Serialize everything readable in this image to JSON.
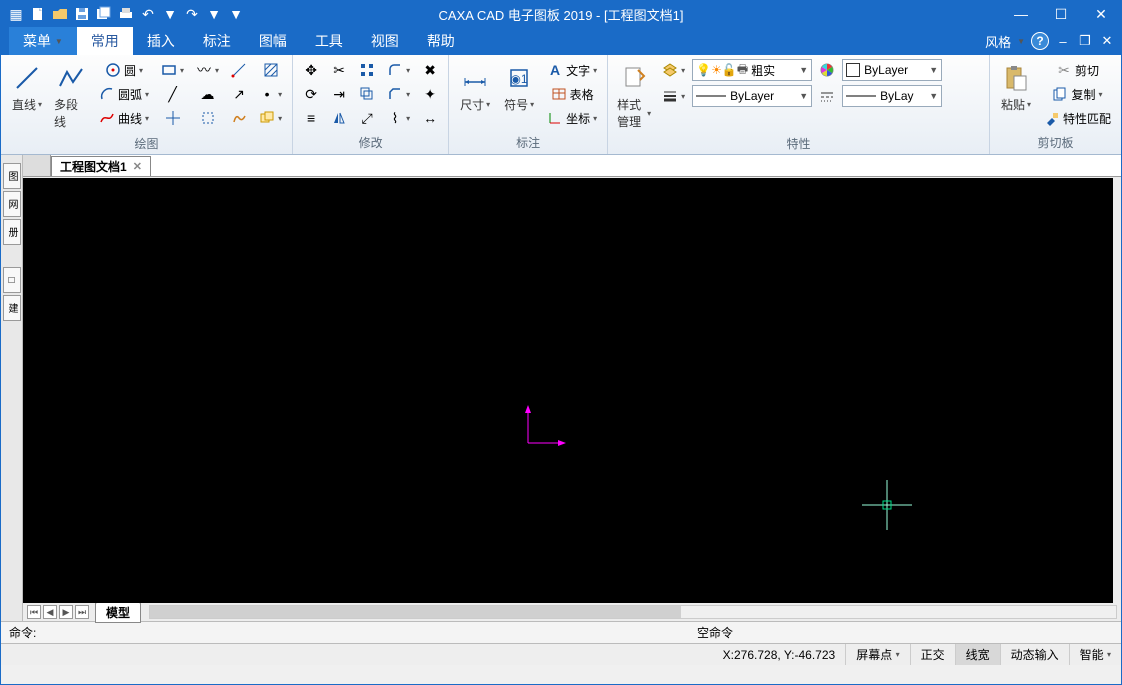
{
  "title": "CAXA CAD 电子图板 2019 - [工程图文档1]",
  "menu": {
    "items": [
      "菜单",
      "常用",
      "插入",
      "标注",
      "图幅",
      "工具",
      "视图",
      "帮助"
    ],
    "active_index": 1,
    "style_label": "风格"
  },
  "ribbon": {
    "panels": {
      "draw": {
        "label": "绘图",
        "line": "直线",
        "pline": "多段线",
        "circle": "圆",
        "arc": "圆弧",
        "curve": "曲线"
      },
      "modify": {
        "label": "修改"
      },
      "annotate": {
        "label": "标注",
        "dim": "尺寸",
        "symbol": "符号",
        "text": "文字",
        "table": "表格",
        "coord": "坐标"
      },
      "props": {
        "label": "特性",
        "style_mgr": "样式管理",
        "lineweight": "粗实",
        "bylayer": "ByLayer",
        "bylayer2": "ByLayer",
        "bylayer3": "ByLay"
      },
      "clipboard": {
        "label": "剪切板",
        "paste": "粘贴",
        "cut": "剪切",
        "copy": "复制",
        "match": "特性匹配"
      }
    }
  },
  "doc": {
    "tab_name": "工程图文档1",
    "model_tab": "模型"
  },
  "cmd": {
    "prompt": "命令:",
    "status": "空命令"
  },
  "status": {
    "coords": "X:276.728, Y:-46.723",
    "screen": "屏幕点",
    "ortho": "正交",
    "lwt": "线宽",
    "dyn": "动态输入",
    "smart": "智能"
  }
}
